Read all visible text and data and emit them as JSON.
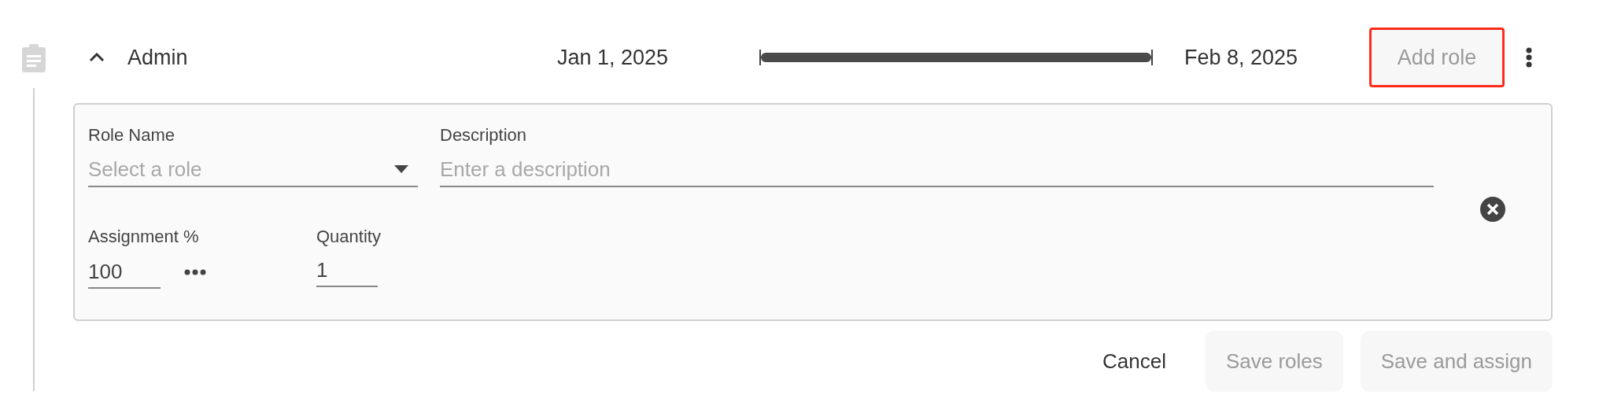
{
  "row": {
    "expanded": true,
    "title": "Admin",
    "start_date": "Jan 1, 2025",
    "end_date": "Feb 8, 2025",
    "add_role_button": {
      "label": "Add role",
      "highlighted": true
    }
  },
  "role_form": {
    "role_name": {
      "label": "Role Name",
      "placeholder": "Select a role"
    },
    "description": {
      "label": "Description",
      "placeholder": "Enter a description"
    },
    "assignment": {
      "label": "Assignment %",
      "value": "100"
    },
    "quantity": {
      "label": "Quantity",
      "value": "1"
    }
  },
  "actions": [
    {
      "label": "Cancel",
      "kind": "text",
      "disabled": false
    },
    {
      "label": "Save roles",
      "kind": "filled",
      "disabled": true
    },
    {
      "label": "Save and assign",
      "kind": "filled",
      "disabled": true
    }
  ]
}
